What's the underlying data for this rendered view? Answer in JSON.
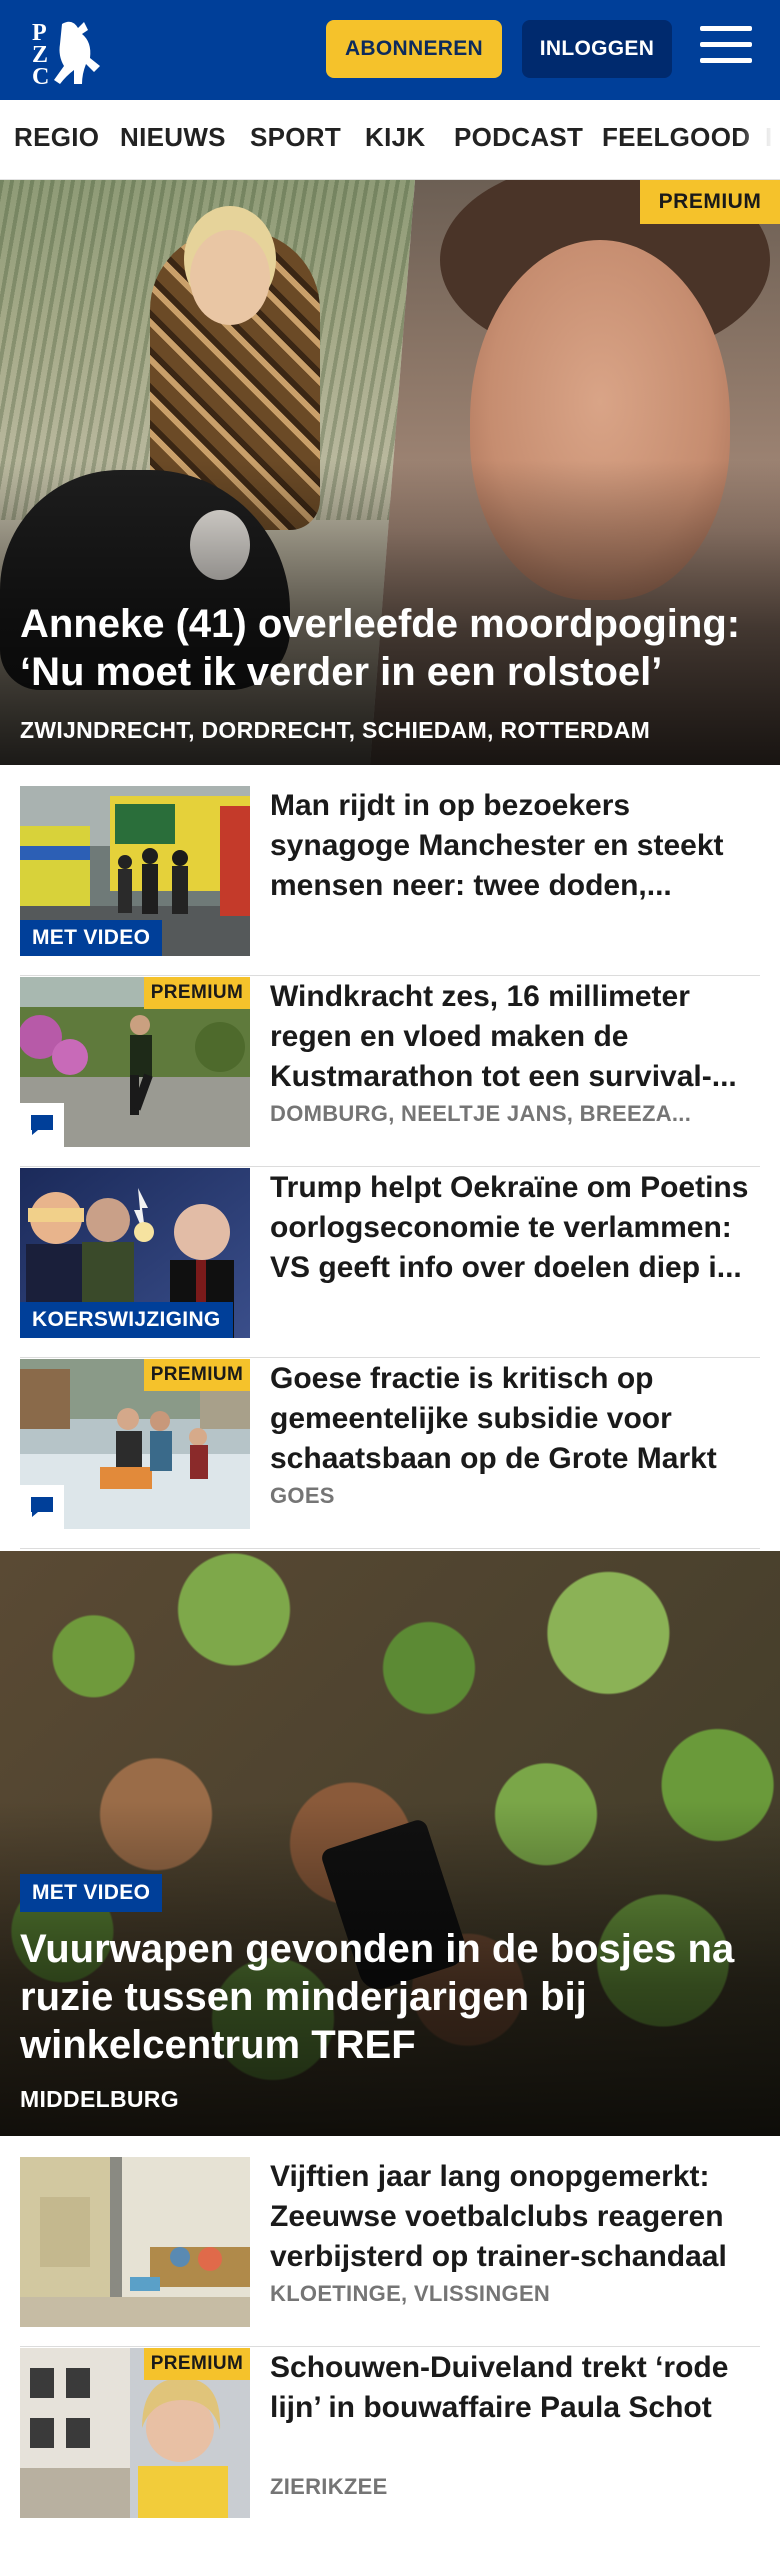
{
  "header": {
    "logo_text": "PZC",
    "subscribe_label": "ABONNEREN",
    "login_label": "INLOGGEN",
    "menu_icon": "hamburger-menu-icon",
    "brand_color": "#003f99",
    "accent_color": "#f5c22b"
  },
  "nav": {
    "items": [
      "REGIO",
      "NIEUWS",
      "SPORT",
      "KIJK",
      "PODCAST",
      "FEELGOOD",
      "I"
    ]
  },
  "hero": {
    "badge": "PREMIUM",
    "title": "Anneke (41) overleefde moordpoging: ‘Nu moet ik verder in een rolstoel’",
    "locations": "ZWIJNDRECHT, DORDRECHT, SCHIEDAM, ROTTERDAM"
  },
  "articles": [
    {
      "title": "Man rijdt in op bezoekers synagoge Manchester en steekt mensen neer: twee doden,...",
      "label": "MET VIDEO",
      "premium": "",
      "locations": ""
    },
    {
      "title": "Windkracht zes, 16 millimeter regen en vloed maken de Kustmarathon tot een survival-...",
      "label": "",
      "premium": "PREMIUM",
      "locations": "DOMBURG, NEELTJE JANS, BREEZA..."
    },
    {
      "title": "Trump helpt Oekraïne om Poetins oorlogseconomie te verlammen: VS geeft info over doelen diep i...",
      "label": "KOERSWIJZIGING",
      "premium": "",
      "locations": ""
    },
    {
      "title": "Goese fractie is kritisch op gemeentelijke subsidie voor schaatsbaan op de Grote Markt",
      "label": "",
      "premium": "PREMIUM",
      "locations": "GOES"
    }
  ],
  "feature": {
    "label": "MET VIDEO",
    "title": "Vuurwapen gevonden in de bosjes na ruzie tussen minderjarigen bij winkelcentrum TREF",
    "locations": "MIDDELBURG"
  },
  "articles_bottom": [
    {
      "title": "Vijftien jaar lang onopgemerkt: Zeeuwse voetbalclubs reageren verbijsterd op trainer-schandaal",
      "premium": "",
      "locations": "KLOETINGE, VLISSINGEN"
    },
    {
      "title": "Schouwen-Duiveland trekt ‘rode lijn’ in bouwaffaire Paula Schot",
      "premium": "PREMIUM",
      "locations": "ZIERIKZEE"
    }
  ]
}
